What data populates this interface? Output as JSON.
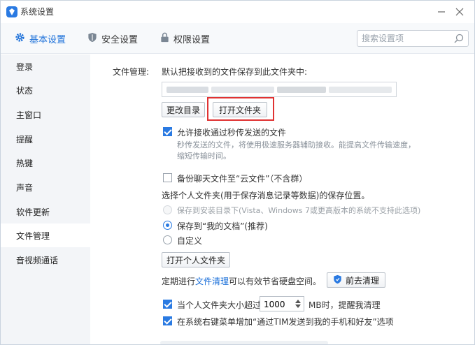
{
  "window": {
    "title": "系统设置"
  },
  "tabs": [
    {
      "label": "基本设置",
      "active": true
    },
    {
      "label": "安全设置",
      "active": false
    },
    {
      "label": "权限设置",
      "active": false
    }
  ],
  "search": {
    "placeholder": "搜索设置项"
  },
  "sidebar": {
    "items": [
      {
        "label": "登录"
      },
      {
        "label": "状态"
      },
      {
        "label": "主窗口"
      },
      {
        "label": "提醒"
      },
      {
        "label": "热键"
      },
      {
        "label": "声音"
      },
      {
        "label": "软件更新"
      },
      {
        "label": "文件管理",
        "active": true
      },
      {
        "label": "音视频通话"
      }
    ]
  },
  "file_mgmt": {
    "section_label": "文件管理:",
    "save_desc": "默认把接收到的文件保存到此文件夹中:",
    "change_dir_button": "更改目录",
    "open_folder_button": "打开文件夹",
    "fast_transfer": {
      "label": "允许接收通过秒传发送的文件",
      "checked": true,
      "desc": "秒传发送的文件，将使用极速服务器辅助接收。能提高文件传输速度，缩短传输时间。"
    },
    "cloud_backup": {
      "label": "备份聊天文件至“云文件”（不含群）",
      "checked": false
    },
    "personal_folder_desc": "选择个人文件夹(用于保存消息记录等数据)的保存位置。",
    "radio_options": [
      {
        "label": "保存到安装目录下(Vista、Windows 7或更高版本的系统不支持此选项)",
        "selected": false,
        "disabled": true
      },
      {
        "label": "保存到“我的文档”(推荐)",
        "selected": true,
        "disabled": false
      },
      {
        "label": "自定义",
        "selected": false,
        "disabled": false
      }
    ],
    "open_personal_folder_button": "打开个人文件夹",
    "cleanup": {
      "prefix": "定期进行",
      "link": "文件清理",
      "suffix": "可以有效节省硬盘空间。",
      "button": "前去清理"
    },
    "size_limit": {
      "prefix": "当个人文件夹大小超过",
      "value": "1000",
      "suffix": "MB时，提醒我清理",
      "checked": true
    },
    "context_menu": {
      "label": "在系统右键菜单增加“通过TIM发送到我的手机和好友”选项",
      "checked": true
    }
  },
  "colors": {
    "accent": "#1a6fd9",
    "highlight_border": "#e03232",
    "checkbox_on": "#2a7ae2"
  }
}
